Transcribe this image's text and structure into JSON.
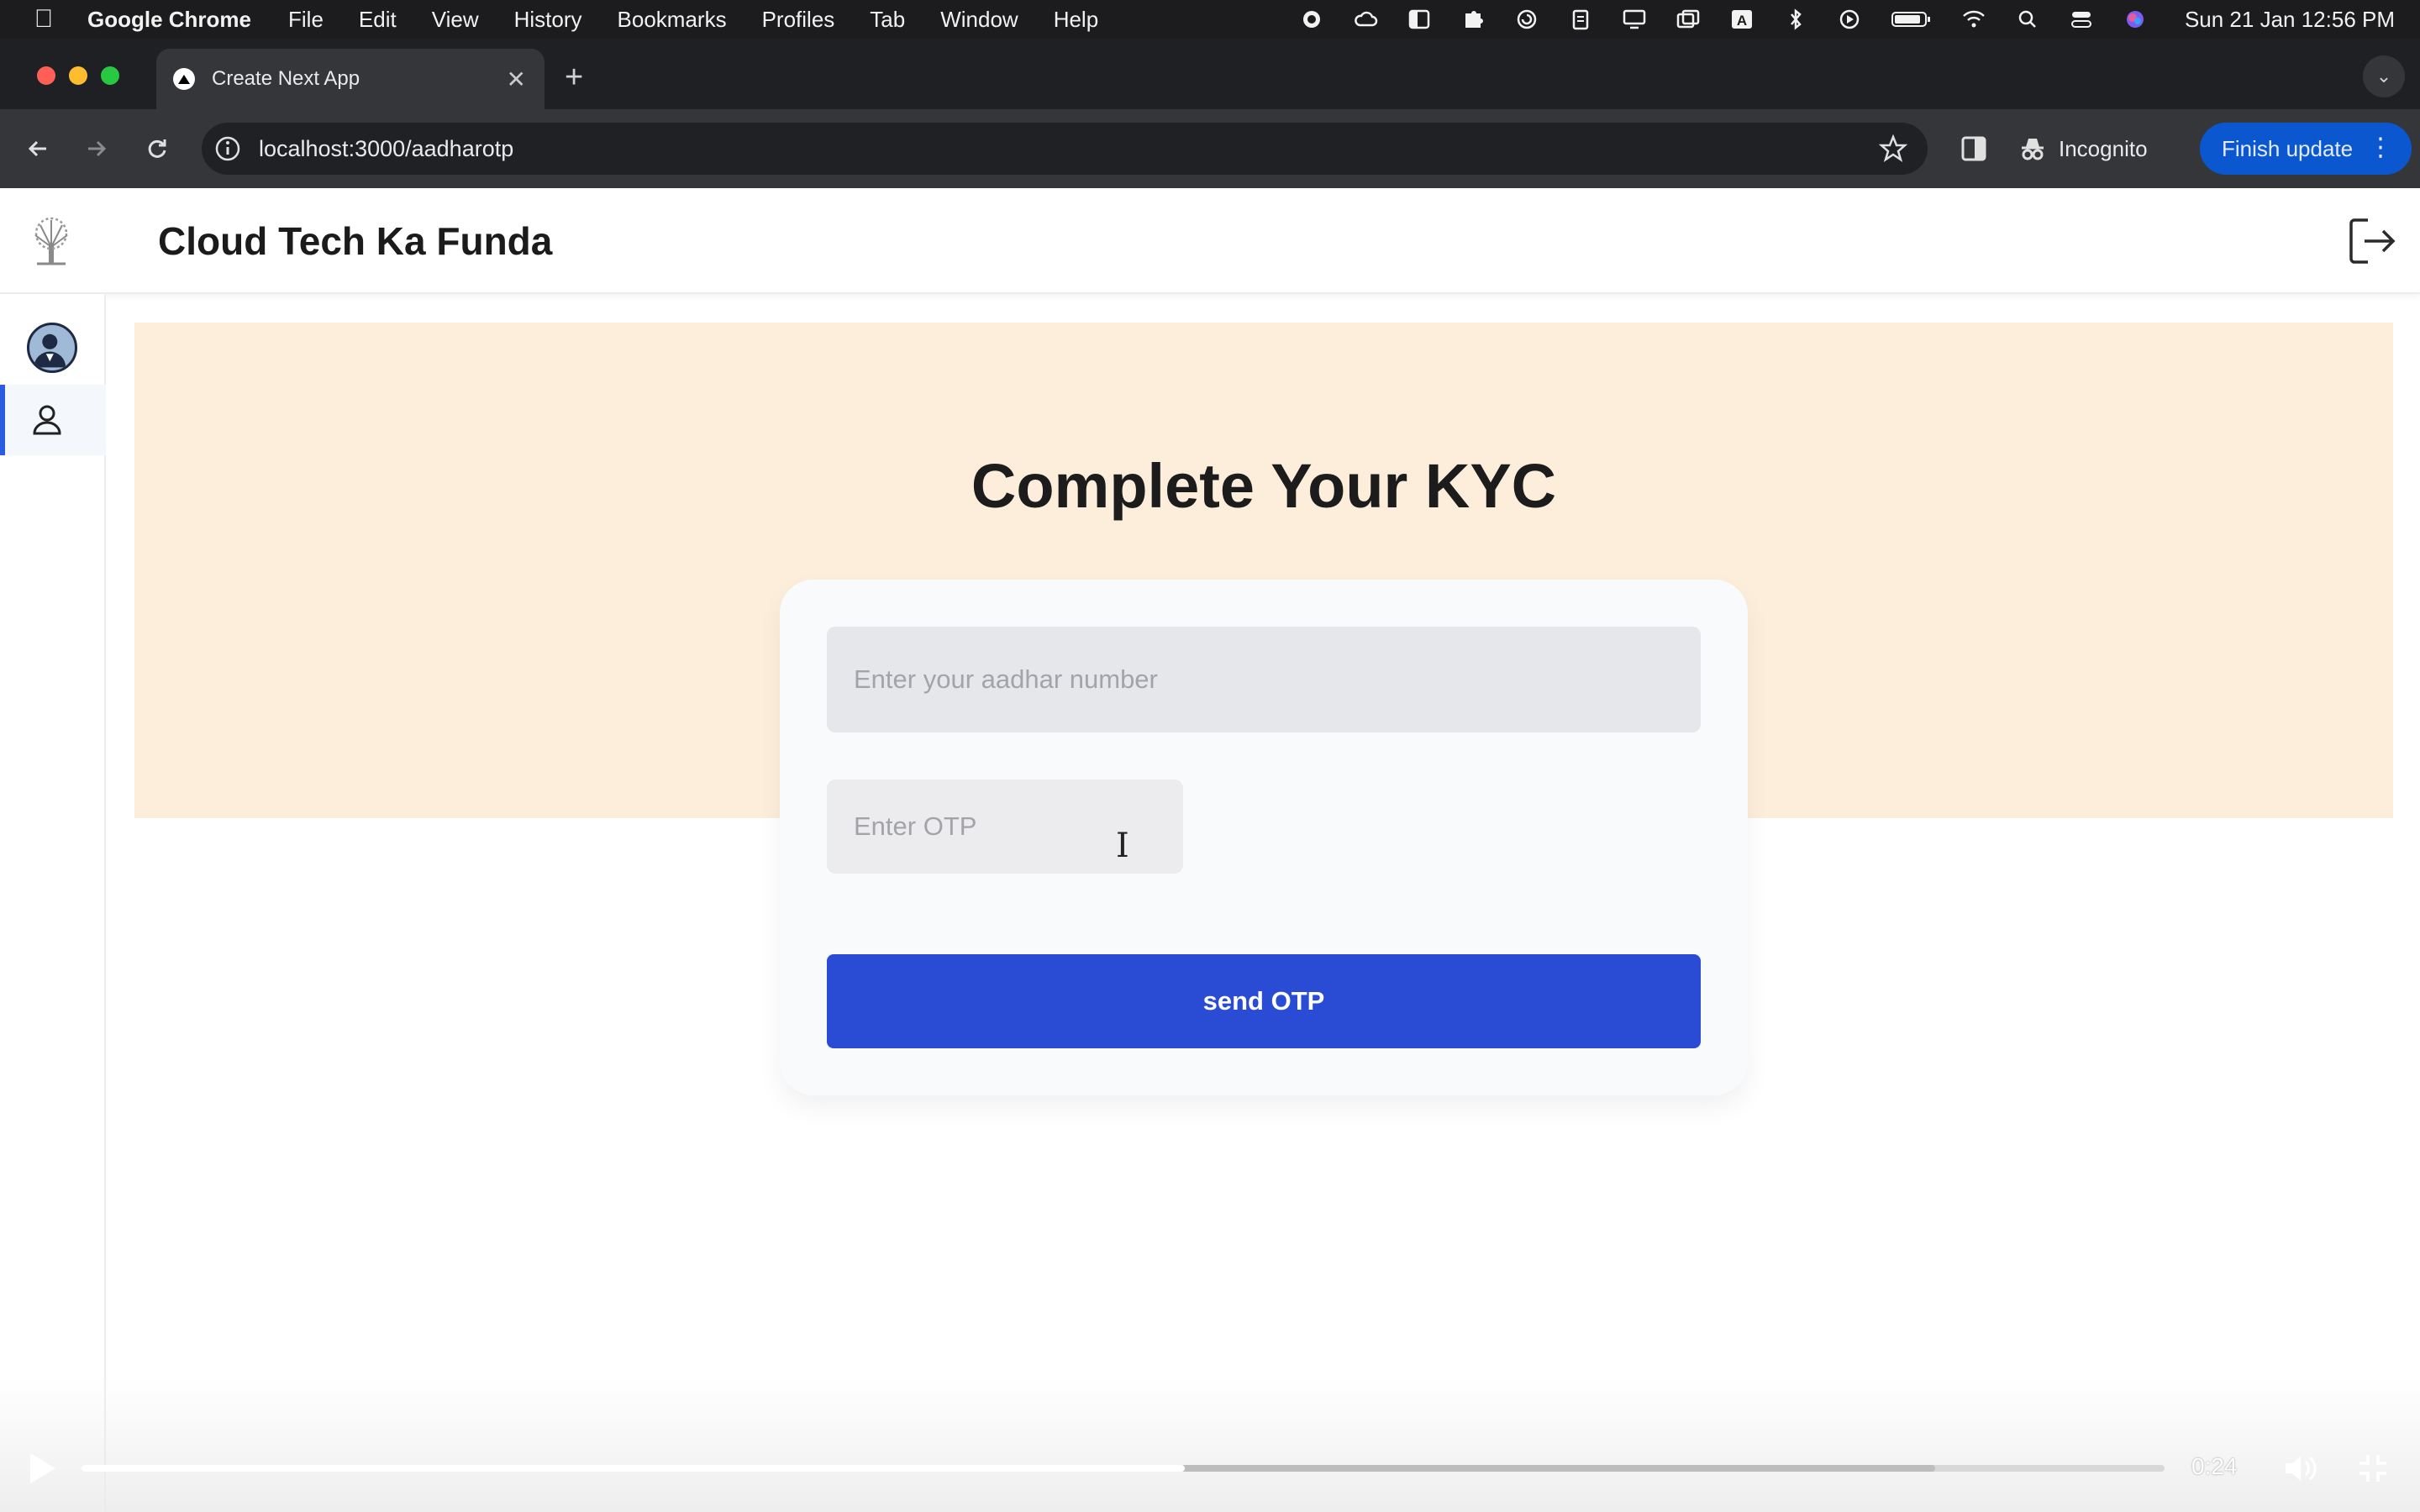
{
  "menubar": {
    "app_name": "Google Chrome",
    "items": [
      "File",
      "Edit",
      "View",
      "History",
      "Bookmarks",
      "Profiles",
      "Tab",
      "Window",
      "Help"
    ],
    "clock": "Sun 21 Jan  12:56 PM",
    "status_icons": [
      "record-icon",
      "cloud-icon",
      "sidebar-icon",
      "puzzle-icon",
      "refresh-circle-icon",
      "clipboard-icon",
      "display-icon",
      "windows-icon",
      "a-box-icon",
      "bluetooth-icon",
      "play-circle-icon",
      "battery-icon",
      "wifi-icon",
      "search-icon",
      "control-center-icon",
      "siri-icon"
    ]
  },
  "browser": {
    "tab_title": "Create Next App",
    "url": "localhost:3000/aadharotp",
    "incognito_label": "Incognito",
    "finish_update_label": "Finish update"
  },
  "app": {
    "brand": "Cloud Tech Ka Funda",
    "title": "Complete Your KYC",
    "aadhar_placeholder": "Enter your aadhar number",
    "otp_placeholder": "Enter OTP",
    "send_button": "send OTP",
    "accent": "#2a4bd3",
    "hero_color": "#fdeedb"
  },
  "video": {
    "time": "0:24",
    "progress": 0.53,
    "buffered": 0.89
  }
}
